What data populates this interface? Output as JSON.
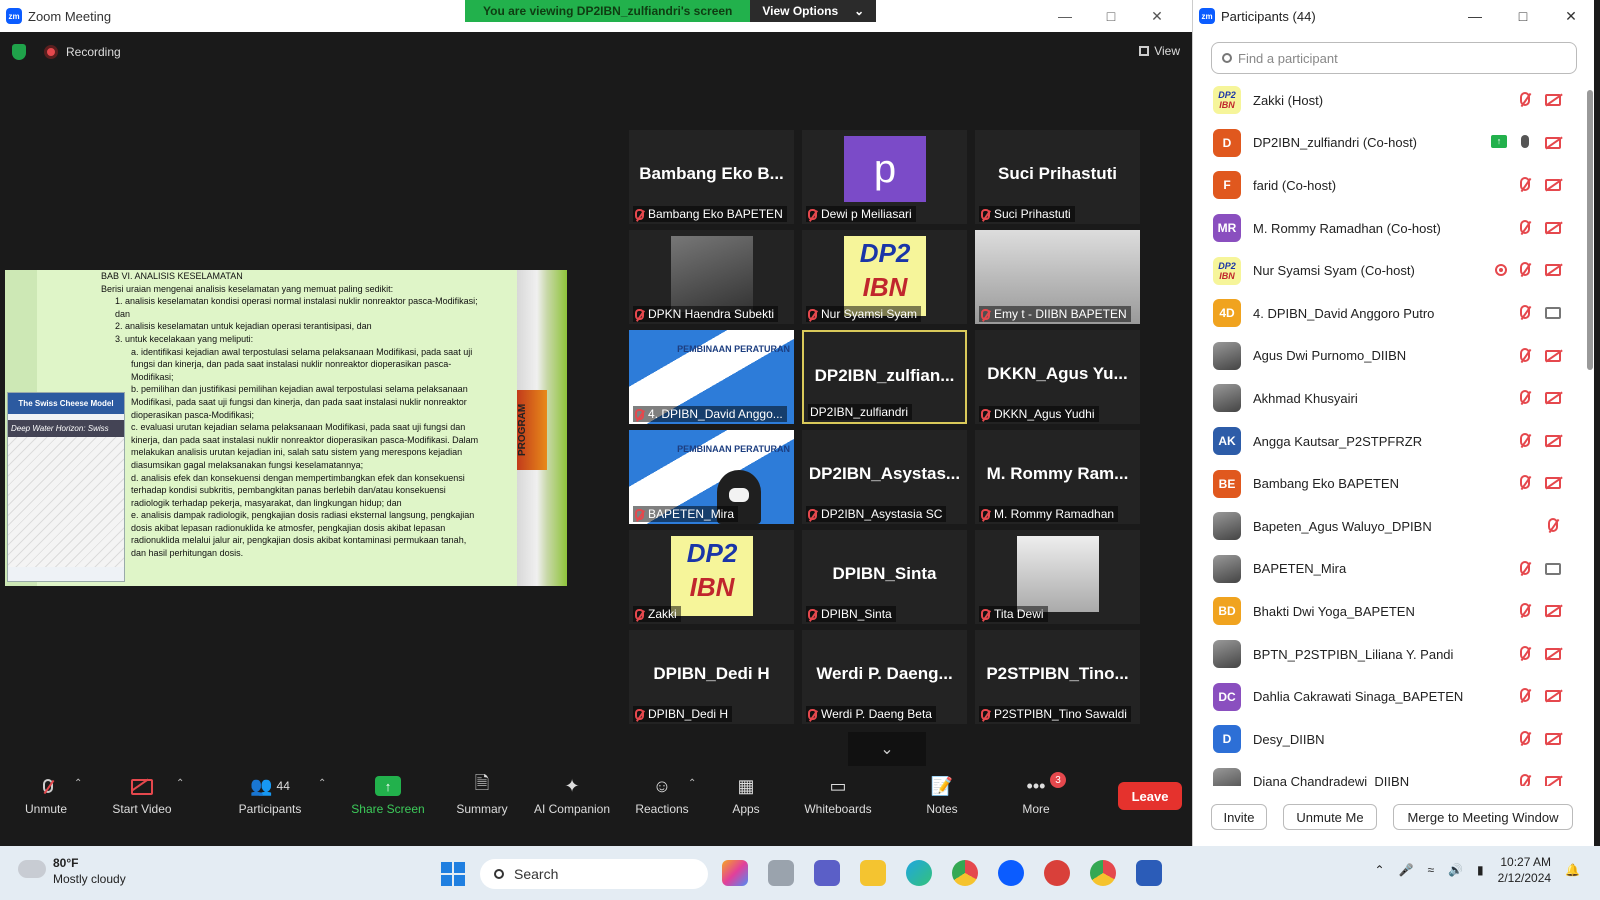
{
  "window": {
    "title": "Zoom Meeting",
    "logo": "zm"
  },
  "share_banner": {
    "text": "You are viewing DP2IBN_zulfiandri's screen",
    "view_options": "View Options"
  },
  "topbar": {
    "recording": "Recording",
    "view": "View"
  },
  "slide": {
    "heading": "BAB VI. ANALISIS KESELAMATAN",
    "intro": "Berisi uraian mengenai analisis keselamatan yang memuat paling sedikit:",
    "items": [
      "1.  analisis keselamatan kondisi operasi normal instalasi nuklir nonreaktor pasca-Modifikasi; dan",
      "2.  analisis keselamatan untuk kejadian operasi terantisipasi, dan",
      "3.  untuk kecelakaan yang meliputi:"
    ],
    "subitems": [
      "a.  identifikasi kejadian awal terpostulasi selama pelaksanaan Modifikasi, pada saat uji fungsi dan kinerja, dan pada saat instalasi nuklir nonreaktor dioperasikan pasca-Modifikasi;",
      "b.  pemilihan dan justifikasi pemilihan kejadian awal terpostulasi selama pelaksanaan Modifikasi, pada saat uji fungsi dan kinerja, dan pada saat instalasi nuklir nonreaktor dioperasikan pasca-Modifikasi;",
      "c.  evaluasi urutan kejadian selama pelaksanaan Modifikasi, pada saat uji fungsi dan kinerja, dan pada saat instalasi nuklir nonreaktor dioperasikan pasca-Modifikasi. Dalam melakukan analisis urutan kejadian ini, salah satu sistem yang merespons kejadian diasumsikan gagal melaksanakan fungsi keselamatannya;",
      "d.  analisis efek dan konsekuensi dengan mempertimbangkan efek dan konsekuensi terhadap kondisi subkritis, pembangkitan panas berlebih dan/atau konsekuensi radiologik terhadap pekerja, masyarakat, dan lingkungan hidup; dan",
      "e.  analisis dampak radiologik, pengkajian dosis radiasi eksternal langsung, pengkajian dosis akibat lepasan radionuklida ke atmosfer, pengkajian dosis akibat lepasan radionuklida melalui jalur air, pengkajian dosis akibat kontaminasi permukaan tanah, dan hasil perhitungan dosis."
    ],
    "image_title": "The Swiss Cheese Model",
    "image_sub": "Deep Water Horizon: Swiss",
    "side_label": "PROGRAM"
  },
  "tiles": [
    {
      "big": "Bambang Eko B...",
      "label": "Bambang Eko BAPETEN",
      "kind": "text"
    },
    {
      "big": "p",
      "label": "Dewi p Meiliasari",
      "kind": "avatar"
    },
    {
      "big": "Suci Prihastuti",
      "label": "Suci Prihastuti",
      "kind": "text"
    },
    {
      "big": "",
      "label": "DPKN Haendra Subekti",
      "kind": "photo"
    },
    {
      "big": "",
      "label": "Nur Syamsi Syam",
      "kind": "logo"
    },
    {
      "big": "",
      "label": "Emy t - DIIBN BAPETEN",
      "kind": "room"
    },
    {
      "big": "",
      "label": "4. DPIBN_David Anggo...",
      "kind": "banner"
    },
    {
      "big": "DP2IBN_zulfian...",
      "label": "DP2IBN_zulfiandri",
      "kind": "text-active"
    },
    {
      "big": "DKKN_Agus Yu...",
      "label": "DKKN_Agus Yudhi",
      "kind": "text"
    },
    {
      "big": "",
      "label": "BAPETEN_Mira",
      "kind": "banner-face"
    },
    {
      "big": "DP2IBN_Asystas...",
      "label": "DP2IBN_Asystasia SC",
      "kind": "text"
    },
    {
      "big": "M. Rommy Ram...",
      "label": "M. Rommy Ramadhan",
      "kind": "text"
    },
    {
      "big": "",
      "label": "Zakki",
      "kind": "logo"
    },
    {
      "big": "DPIBN_Sinta",
      "label": "DPIBN_Sinta",
      "kind": "text"
    },
    {
      "big": "",
      "label": "Tita Dewi",
      "kind": "bw"
    },
    {
      "big": "DPIBN_Dedi H",
      "label": "DPIBN_Dedi H",
      "kind": "text"
    },
    {
      "big": "Werdi P. Daeng...",
      "label": "Werdi P. Daeng Beta",
      "kind": "text"
    },
    {
      "big": "P2STPIBN_Tino...",
      "label": "P2STPIBN_Tino Sawaldi",
      "kind": "text"
    }
  ],
  "banner_tile_text": "PEMBINAAN PERATURAN",
  "logo_text": {
    "top": "DP2",
    "bottom": "IBN"
  },
  "toolbar": {
    "unmute": "Unmute",
    "start_video": "Start Video",
    "participants": "Participants",
    "participants_count": "44",
    "share_screen": "Share Screen",
    "summary": "Summary",
    "ai_companion": "AI Companion",
    "reactions": "Reactions",
    "apps": "Apps",
    "whiteboards": "Whiteboards",
    "notes": "Notes",
    "more": "More",
    "more_badge": "3",
    "leave": "Leave"
  },
  "panel": {
    "title": "Participants (44)",
    "search_placeholder": "Find a participant",
    "participants": [
      {
        "name": "Zakki (Host)",
        "avatar": "DP2IBN",
        "color": "",
        "video": "off"
      },
      {
        "name": "DP2IBN_zulfiandri (Co-host)",
        "avatar": "D",
        "color": "#e0581e",
        "video": "off",
        "sharing": true,
        "mic": "on"
      },
      {
        "name": "farid (Co-host)",
        "avatar": "F",
        "color": "#e0581e",
        "video": "off"
      },
      {
        "name": "M. Rommy Ramadhan (Co-host)",
        "avatar": "MR",
        "color": "#8a4fbf",
        "video": "off"
      },
      {
        "name": "Nur Syamsi Syam (Co-host)",
        "avatar": "DP2IBN",
        "color": "",
        "video": "off",
        "recording": true
      },
      {
        "name": "4. DPIBN_David Anggoro Putro",
        "avatar": "4D",
        "color": "#f0a31f",
        "video": "on"
      },
      {
        "name": "Agus Dwi Purnomo_DIIBN",
        "avatar": "photo",
        "color": "",
        "video": "off"
      },
      {
        "name": "Akhmad Khusyairi",
        "avatar": "photo",
        "color": "",
        "video": "off"
      },
      {
        "name": "Angga Kautsar_P2STPFRZR",
        "avatar": "AK",
        "color": "#2d5ca8",
        "video": "off"
      },
      {
        "name": "Bambang Eko BAPETEN",
        "avatar": "BE",
        "color": "#e0581e",
        "video": "off"
      },
      {
        "name": "Bapeten_Agus Waluyo_DPIBN",
        "avatar": "photo",
        "color": "",
        "video": "none"
      },
      {
        "name": "BAPETEN_Mira",
        "avatar": "photo",
        "color": "",
        "video": "on"
      },
      {
        "name": "Bhakti Dwi Yoga_BAPETEN",
        "avatar": "BD",
        "color": "#f0a31f",
        "video": "off"
      },
      {
        "name": "BPTN_P2STPIBN_Liliana Y. Pandi",
        "avatar": "photo",
        "color": "",
        "video": "off"
      },
      {
        "name": "Dahlia Cakrawati Sinaga_BAPETEN",
        "avatar": "DC",
        "color": "#8a4fbf",
        "video": "off"
      },
      {
        "name": "Desy_DIIBN",
        "avatar": "D",
        "color": "#2d6fd6",
        "video": "off"
      },
      {
        "name": "Diana Chandradewi_DIIBN",
        "avatar": "photo",
        "color": "",
        "video": "off"
      }
    ],
    "invite": "Invite",
    "unmute_me": "Unmute Me",
    "merge": "Merge to Meeting Window"
  },
  "taskbar": {
    "temperature": "80°F",
    "weather": "Mostly cloudy",
    "search": "Search",
    "time": "10:27 AM",
    "date": "2/12/2024"
  }
}
